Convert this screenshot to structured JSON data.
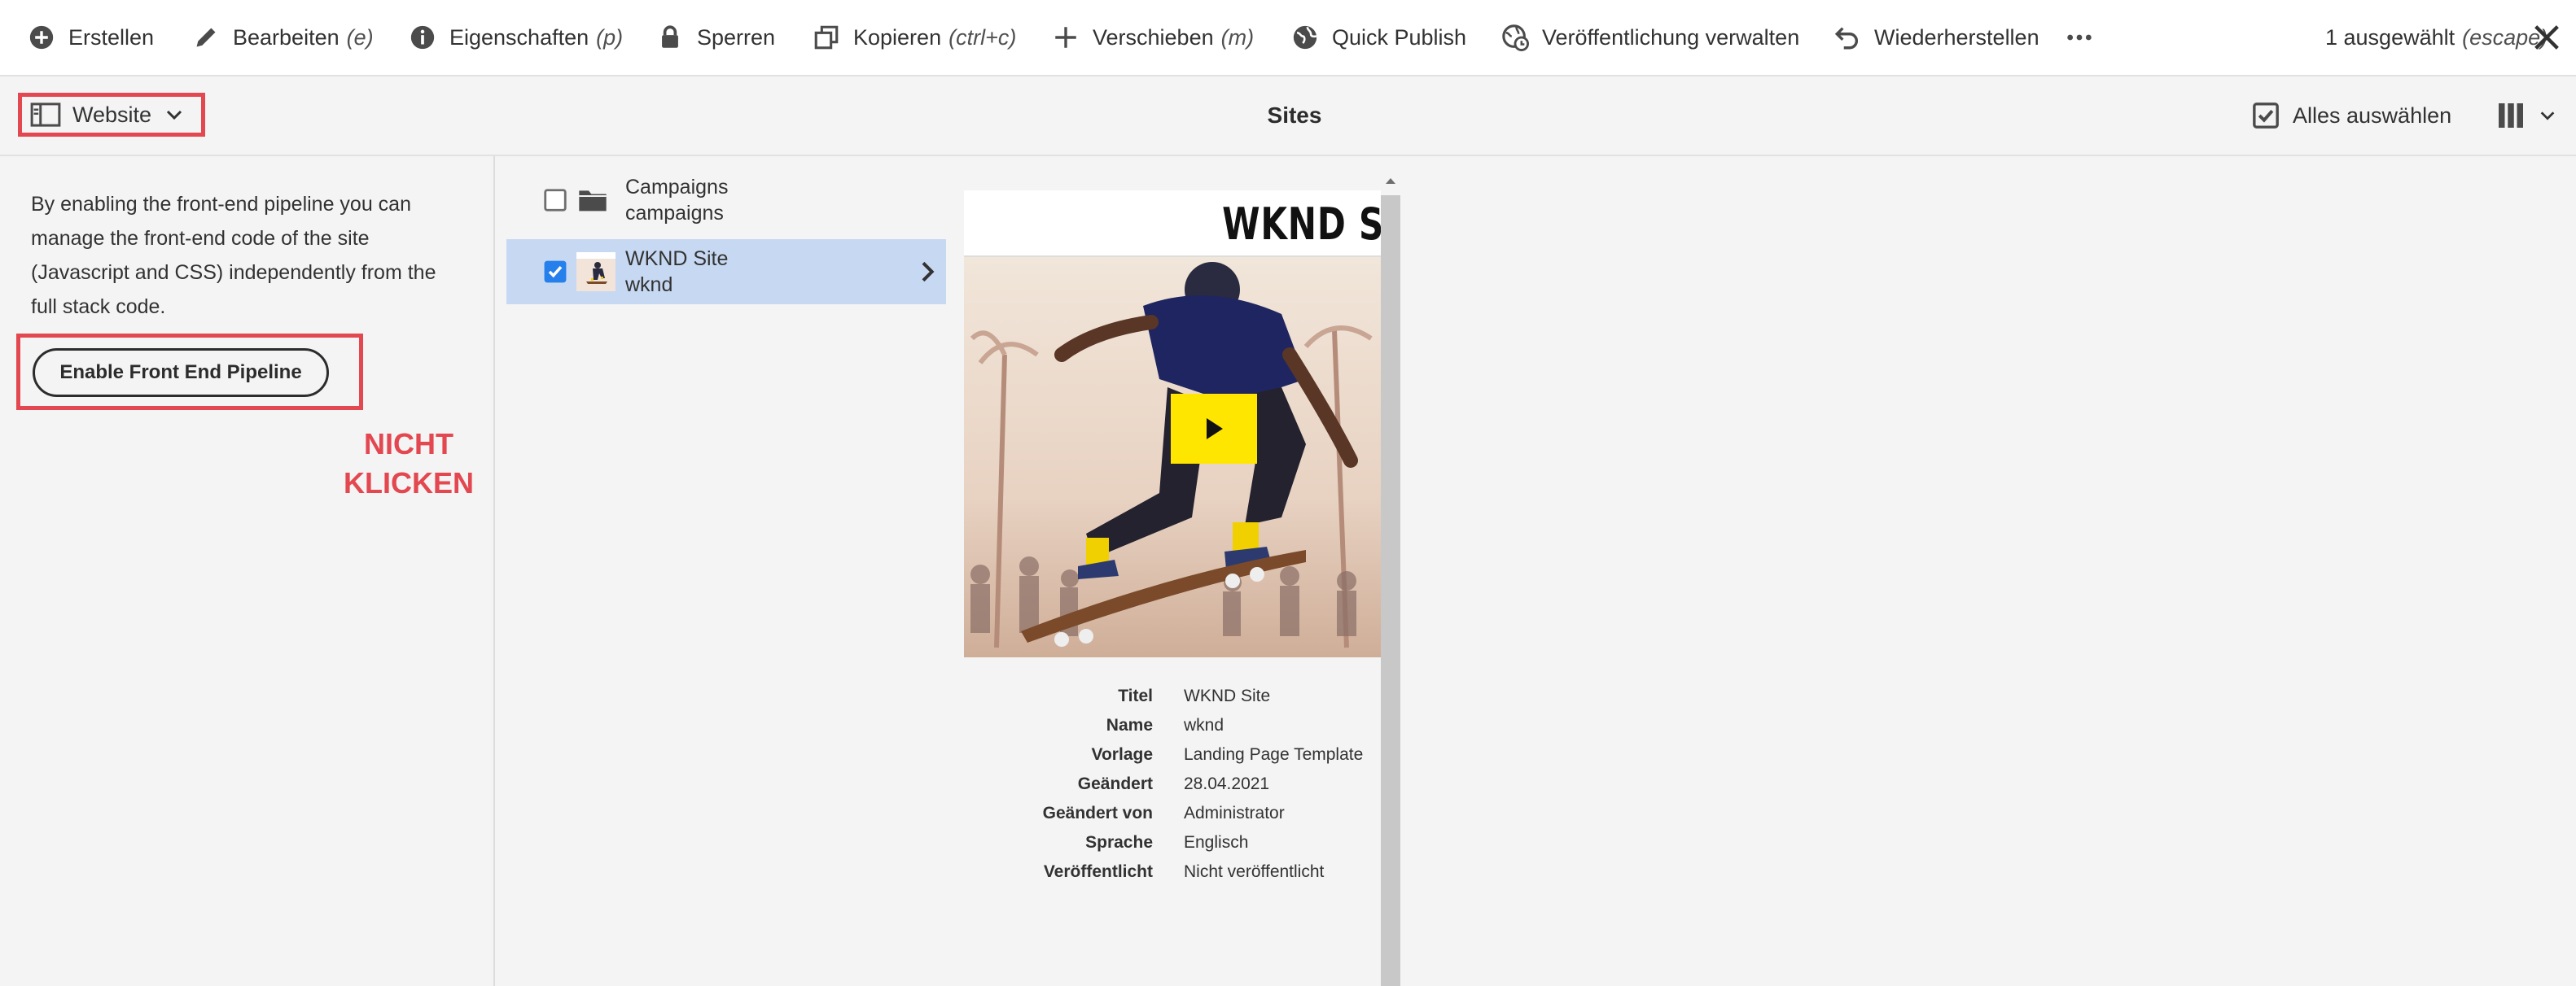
{
  "toolbar": {
    "items": [
      {
        "label": "Erstellen",
        "shortcut": "",
        "icon": "add-circle-icon"
      },
      {
        "label": "Bearbeiten",
        "shortcut": "(e)",
        "icon": "pencil-icon"
      },
      {
        "label": "Eigenschaften",
        "shortcut": "(p)",
        "icon": "info-icon"
      },
      {
        "label": "Sperren",
        "shortcut": "",
        "icon": "lock-icon"
      },
      {
        "label": "Kopieren",
        "shortcut": "(ctrl+c)",
        "icon": "copy-icon"
      },
      {
        "label": "Verschieben",
        "shortcut": "(m)",
        "icon": "move-icon"
      },
      {
        "label": "Quick Publish",
        "shortcut": "",
        "icon": "globe-icon"
      },
      {
        "label": "Veröffentlichung verwalten",
        "shortcut": "",
        "icon": "globe-clock-icon"
      },
      {
        "label": "Wiederherstellen",
        "shortcut": "",
        "icon": "revert-icon"
      }
    ],
    "more_icon": "more-icon",
    "selection_count": "1 ausgewählt",
    "selection_shortcut": "(escape)",
    "close_icon": "close-icon"
  },
  "header": {
    "rail_label": "Website",
    "title": "Sites",
    "select_all": "Alles auswählen",
    "view_icon": "column-view-icon"
  },
  "rail": {
    "description": "By enabling the front-end pipeline you can manage the front-end code of the site (Javascript and CSS) independently from the full stack code.",
    "button_label": "Enable Front End Pipeline",
    "warning_line1": "NICHT",
    "warning_line2": "KLICKEN"
  },
  "columns": {
    "items": [
      {
        "title": "Campaigns",
        "name": "campaigns",
        "type": "folder",
        "selected": false
      },
      {
        "title": "WKND Site",
        "name": "wknd",
        "type": "page",
        "selected": true
      }
    ]
  },
  "preview": {
    "logo_text": "WKND S",
    "meta": [
      {
        "key": "Titel",
        "value": "WKND Site"
      },
      {
        "key": "Name",
        "value": "wknd"
      },
      {
        "key": "Vorlage",
        "value": "Landing Page Template"
      },
      {
        "key": "Geändert",
        "value": "28.04.2021"
      },
      {
        "key": "Geändert von",
        "value": "Administrator"
      },
      {
        "key": "Sprache",
        "value": "Englisch"
      },
      {
        "key": "Veröffentlicht",
        "value": "Nicht veröffentlicht"
      }
    ]
  },
  "colors": {
    "accent_red": "#e34850",
    "selection_blue": "#c7d8f2",
    "checkbox_blue": "#2680eb",
    "play_yellow": "#ffe600"
  }
}
